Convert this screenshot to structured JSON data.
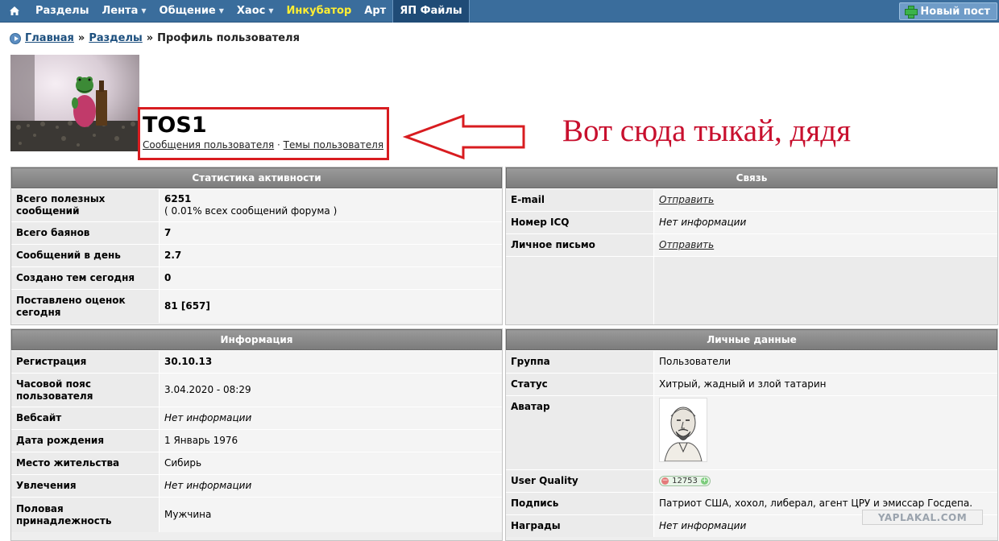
{
  "nav": {
    "home_icon": "home-icon",
    "items": [
      {
        "label": "Разделы",
        "dropdown": false
      },
      {
        "label": "Лента",
        "dropdown": true
      },
      {
        "label": "Общение",
        "dropdown": true
      },
      {
        "label": "Хаос",
        "dropdown": true
      },
      {
        "label": "Инкубатор",
        "dropdown": false
      },
      {
        "label": "Арт",
        "dropdown": false
      },
      {
        "label": "ЯП Файлы",
        "dropdown": false
      }
    ],
    "new_post": "Новый пост"
  },
  "breadcrumb": {
    "home": "Главная",
    "sep1": "»",
    "sections": "Разделы",
    "sep2": "»",
    "current": "Профиль пользователя"
  },
  "profile": {
    "username": "TOS1",
    "link_posts": "Сообщения пользователя",
    "link_sep": "·",
    "link_topics": "Темы пользователя"
  },
  "annotation": "Вот сюда тыкай, дядя",
  "colors": {
    "nav_bg": "#3a6d9c",
    "annotation_red": "#d81c20"
  },
  "stats": {
    "title": "Статистика активности",
    "rows": [
      {
        "label": "Всего полезных сообщений",
        "value": "6251",
        "sub": "( 0.01% всех сообщений форума )"
      },
      {
        "label": "Всего баянов",
        "value": "7"
      },
      {
        "label": "Сообщений в день",
        "value": "2.7"
      },
      {
        "label": "Создано тем сегодня",
        "value": "0"
      },
      {
        "label": "Поставлено оценок сегодня",
        "value": "81 [657]"
      }
    ]
  },
  "contact": {
    "title": "Связь",
    "rows": [
      {
        "label": "E-mail",
        "value": "Отправить"
      },
      {
        "label": "Номер ICQ",
        "value": "Нет информации"
      },
      {
        "label": "Личное письмо",
        "value": "Отправить"
      }
    ]
  },
  "info": {
    "title": "Информация",
    "rows": [
      {
        "label": "Регистрация",
        "value": "30.10.13"
      },
      {
        "label": "Часовой пояс пользователя",
        "value": "3.04.2020 - 08:29"
      },
      {
        "label": "Вебсайт",
        "value": "Нет информации"
      },
      {
        "label": "Дата рождения",
        "value": "1 Январь 1976"
      },
      {
        "label": "Место жительства",
        "value": "Сибирь"
      },
      {
        "label": "Увлечения",
        "value": "Нет информации"
      },
      {
        "label": "Половая принадлежность",
        "value": "Мужчина"
      }
    ]
  },
  "personal": {
    "title": "Личные данные",
    "rows": [
      {
        "label": "Группа",
        "value": "Пользователи"
      },
      {
        "label": "Статус",
        "value": "Хитрый, жадный и злой татарин"
      },
      {
        "label": "Аватар",
        "value": ""
      },
      {
        "label": "User Quality",
        "value": "12753",
        "minus": "−",
        "plus": "+"
      },
      {
        "label": "Подпись",
        "value": "Патриот США, хохол, либерал, агент ЦРУ и эмиссар Госдепа."
      },
      {
        "label": "Награды",
        "value": "Нет информации"
      }
    ]
  },
  "watermark": "YAPLAKAL.COM"
}
